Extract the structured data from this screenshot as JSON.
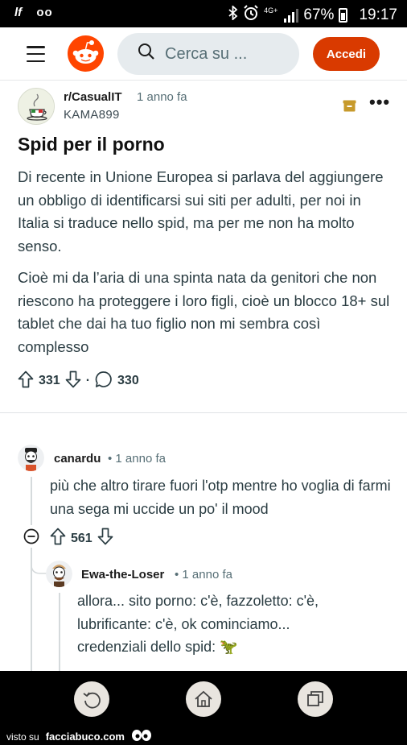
{
  "status_bar": {
    "left_text": "lf",
    "battery": "67%",
    "time": "19:17",
    "network": "4G+"
  },
  "header": {
    "search_placeholder": "Cerca su ...",
    "login_label": "Accedi"
  },
  "post": {
    "subreddit": "r/CasualIT",
    "time": "1 anno fa",
    "author": "KAMA899",
    "title": "Spid per il porno",
    "paragraphs": [
      "Di recente in Unione Europea si parlava del aggiungere un obbligo di identificarsi sui siti per adulti, per noi in Italia si traduce nello spid, ma per me non ha molto senso.",
      "Cioè mi da l’aria di una spinta nata da genitori che non riescono ha proteggere i loro figli, cioè un blocco 18+ sul tablet che dai ha tuo figlio non mi sembra così complesso"
    ],
    "upvotes": "331",
    "comments": "330"
  },
  "comments": [
    {
      "author": "canardu",
      "time": "1 anno fa",
      "body": "più che altro tirare fuori l'otp mentre ho voglia di farmi una sega mi uccide un po' il mood",
      "votes": "561"
    },
    {
      "author": "Ewa-the-Loser",
      "time": "1 anno fa",
      "body": "allora... sito porno: c'è, fazzoletto: c'è, lubrificante: c'è, ok cominciamo... credenziali dello spid: 🦖"
    }
  ],
  "watermark": {
    "prefix": "visto su",
    "site": "facciabuco.com"
  },
  "colors": {
    "brand": "#ff4500",
    "login_bg": "#d93a00",
    "archive": "#c79a2b"
  }
}
